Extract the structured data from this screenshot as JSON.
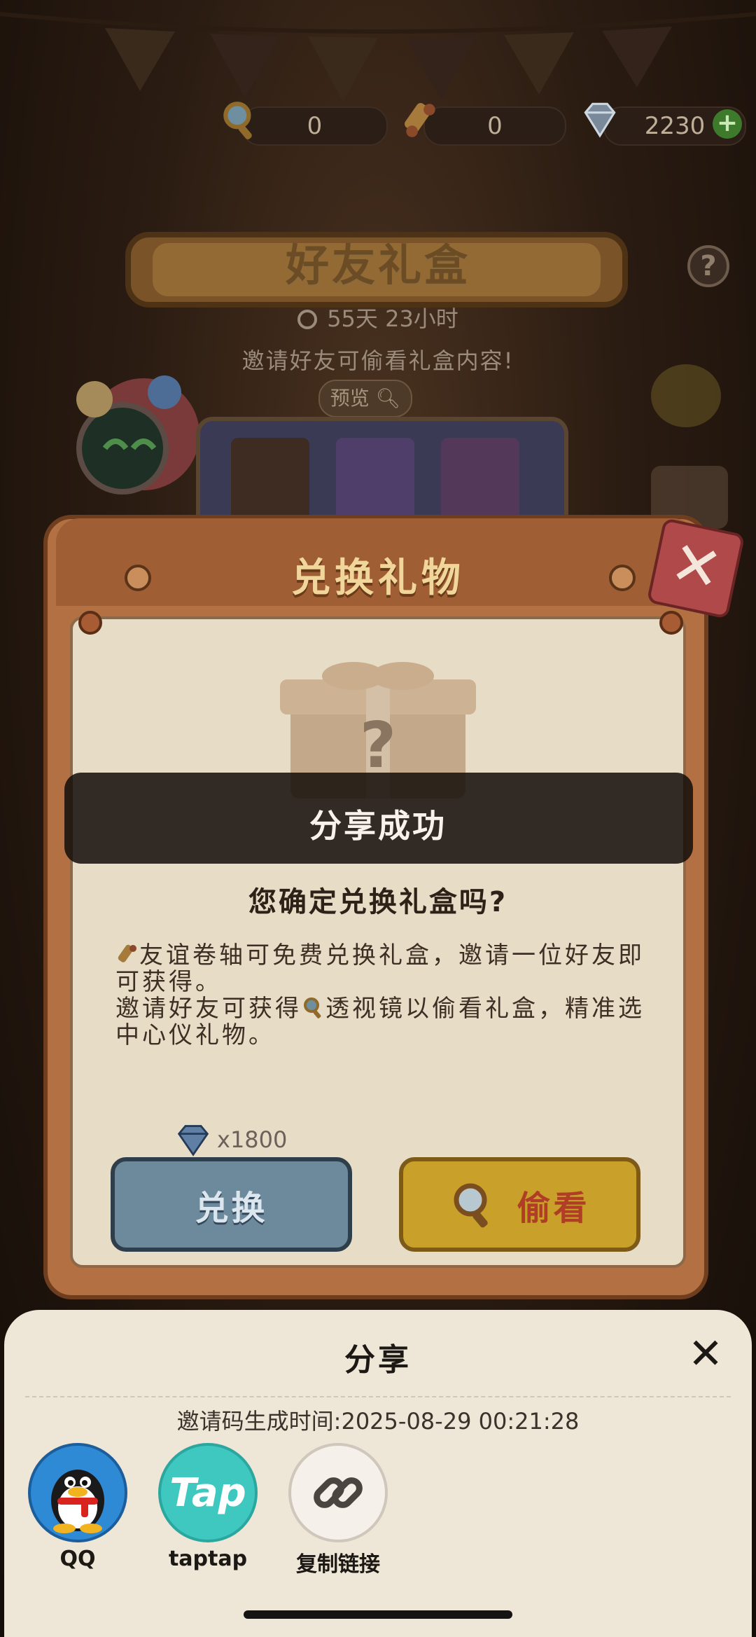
{
  "currency": {
    "magnifier_count": "0",
    "scroll_count": "0",
    "diamond_count": "2230",
    "add_label": "+"
  },
  "event": {
    "title": "好友礼盒",
    "countdown": "55天  23小时",
    "invite_tip": "邀请好友可偷看礼盒内容!",
    "preview_label": "预览",
    "help_label": "?"
  },
  "dialog": {
    "title": "兑换礼物",
    "close_label": "✕",
    "toast": "分享成功",
    "question": "您确定兑换礼盒吗?",
    "desc_line1": "友谊卷轴可免费兑换礼盒，邀请一位好友即可获得。",
    "desc_line2_pre": "邀请好友可获得",
    "desc_line2_post": "透视镜以偷看礼盒，精准选中心仪礼物。",
    "price": "x1800",
    "exchange_label": "兑换",
    "peek_label": "偷看"
  },
  "share": {
    "title": "分享",
    "close_label": "✕",
    "code_time": "邀请码生成时间:2025-08-29  00:21:28",
    "targets": [
      {
        "label": "QQ",
        "icon": "qq-icon"
      },
      {
        "label": "taptap",
        "icon": "taptap-icon",
        "logo_text": "Tap"
      },
      {
        "label": "复制链接",
        "icon": "link-icon"
      }
    ]
  },
  "colors": {
    "exchange_button": "#6c8a9c",
    "peek_button": "#c9a02a",
    "dialog_frame": "#b27043",
    "sheet_bg": "#eee6d6"
  }
}
